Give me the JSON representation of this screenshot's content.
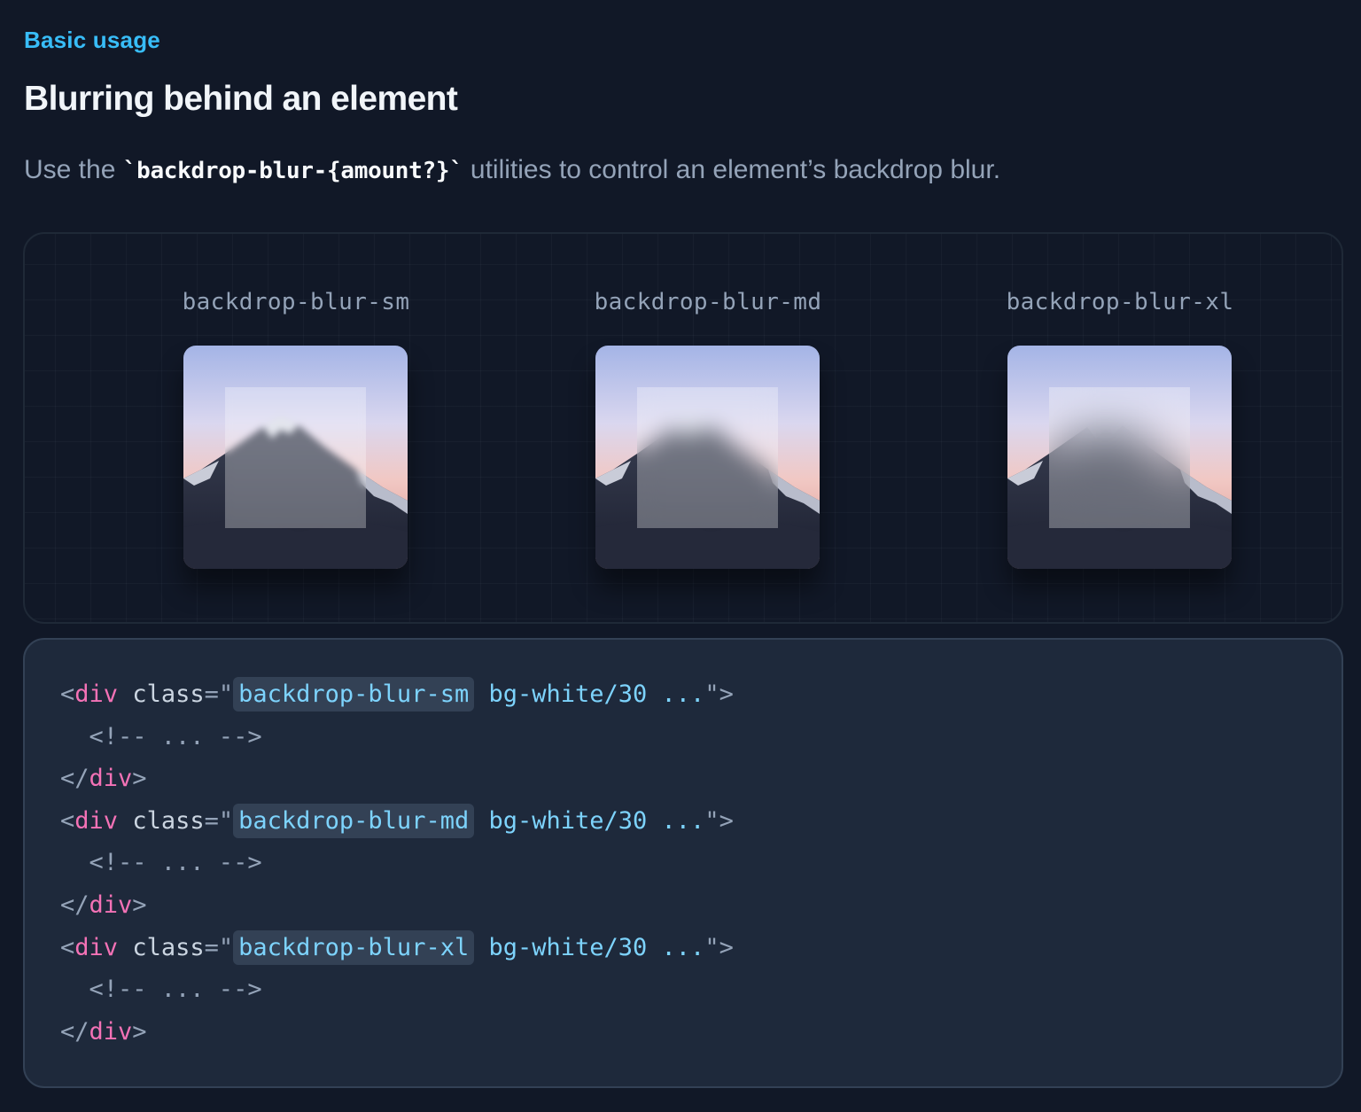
{
  "section": {
    "eyebrow": "Basic usage",
    "title": "Blurring behind an element",
    "description_prefix": "Use the ",
    "description_code": "`backdrop-blur-{amount?}`",
    "description_suffix": " utilities to control an element’s backdrop blur."
  },
  "demo": {
    "items": [
      {
        "label": "backdrop-blur-sm",
        "blur": "sm"
      },
      {
        "label": "backdrop-blur-md",
        "blur": "md"
      },
      {
        "label": "backdrop-blur-xl",
        "blur": "xl"
      }
    ],
    "image": "mountain-photo"
  },
  "code": {
    "blocks": [
      {
        "open_lt": "<",
        "tag": "div",
        "attr": "class",
        "eq": "=",
        "q1": "\"",
        "class_hl": "backdrop-blur-sm",
        "class_rest": " bg-white/30 ...",
        "q2": "\"",
        "gt": ">",
        "comment": "  <!-- ... -->",
        "close": "</",
        "close_tag": "div",
        "close_gt": ">"
      },
      {
        "open_lt": "<",
        "tag": "div",
        "attr": "class",
        "eq": "=",
        "q1": "\"",
        "class_hl": "backdrop-blur-md",
        "class_rest": " bg-white/30 ...",
        "q2": "\"",
        "gt": ">",
        "comment": "  <!-- ... -->",
        "close": "</",
        "close_tag": "div",
        "close_gt": ">"
      },
      {
        "open_lt": "<",
        "tag": "div",
        "attr": "class",
        "eq": "=",
        "q1": "\"",
        "class_hl": "backdrop-blur-xl",
        "class_rest": " bg-white/30 ...",
        "q2": "\"",
        "gt": ">",
        "comment": "  <!-- ... -->",
        "close": "</",
        "close_tag": "div",
        "close_gt": ">"
      }
    ]
  },
  "colors": {
    "background": "#111827",
    "accent": "#38bdf8",
    "code_background": "#1e293b",
    "tag": "#f472b6",
    "string": "#7dd3fc"
  }
}
